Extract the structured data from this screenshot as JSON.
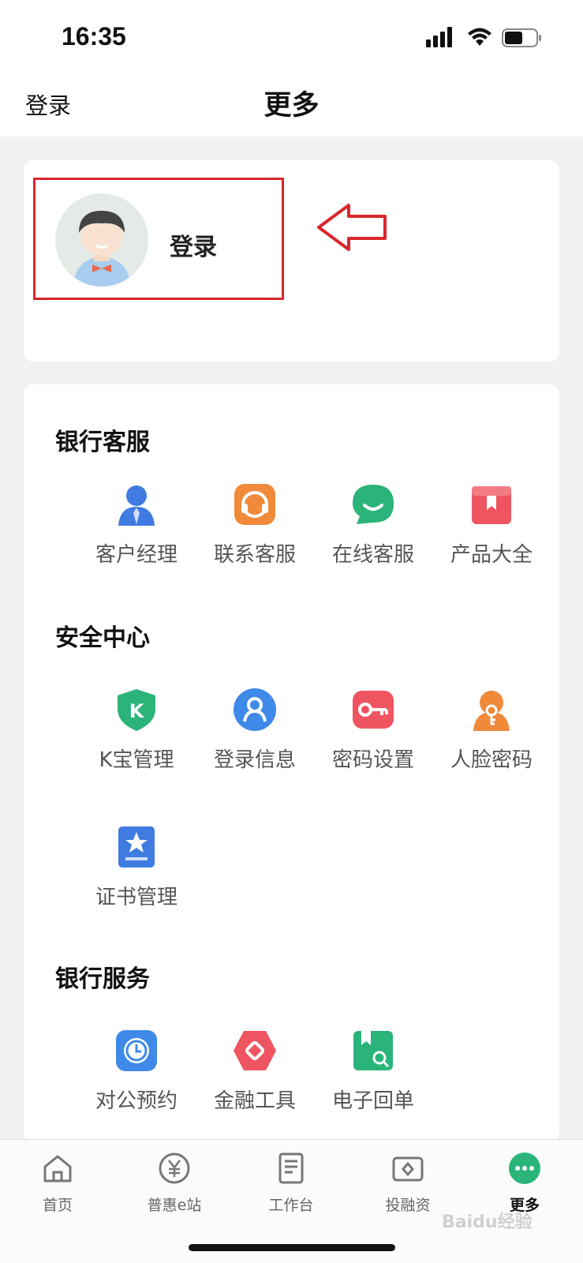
{
  "status_bar": {
    "time": "16:35"
  },
  "nav": {
    "left_label": "登录",
    "title": "更多"
  },
  "login_card": {
    "label": "登录"
  },
  "sections": {
    "customer_service": {
      "title": "银行客服",
      "items": [
        {
          "label": "客户经理",
          "icon": "account-manager-icon"
        },
        {
          "label": "联系客服",
          "icon": "headset-icon"
        },
        {
          "label": "在线客服",
          "icon": "chat-bubble-icon"
        },
        {
          "label": "产品大全",
          "icon": "product-box-icon"
        }
      ]
    },
    "security": {
      "title": "安全中心",
      "items": [
        {
          "label": "K宝管理",
          "icon": "k-shield-icon"
        },
        {
          "label": "登录信息",
          "icon": "user-badge-icon"
        },
        {
          "label": "密码设置",
          "icon": "key-icon"
        },
        {
          "label": "人脸密码",
          "icon": "face-key-icon"
        },
        {
          "label": "证书管理",
          "icon": "certificate-icon"
        }
      ]
    },
    "bank_services": {
      "title": "银行服务",
      "items": [
        {
          "label": "对公预约",
          "icon": "clock-icon"
        },
        {
          "label": "金融工具",
          "icon": "finance-tool-icon"
        },
        {
          "label": "电子回单",
          "icon": "receipt-search-icon"
        }
      ]
    }
  },
  "tabs": [
    {
      "label": "首页",
      "icon": "home-icon"
    },
    {
      "label": "普惠e站",
      "icon": "yen-icon"
    },
    {
      "label": "工作台",
      "icon": "document-icon"
    },
    {
      "label": "投融资",
      "icon": "wallet-icon"
    },
    {
      "label": "更多",
      "icon": "more-icon"
    }
  ],
  "watermark": "Baidu经验",
  "colors": {
    "accent": "#2bb47a",
    "highlight_box": "#d9262c"
  }
}
